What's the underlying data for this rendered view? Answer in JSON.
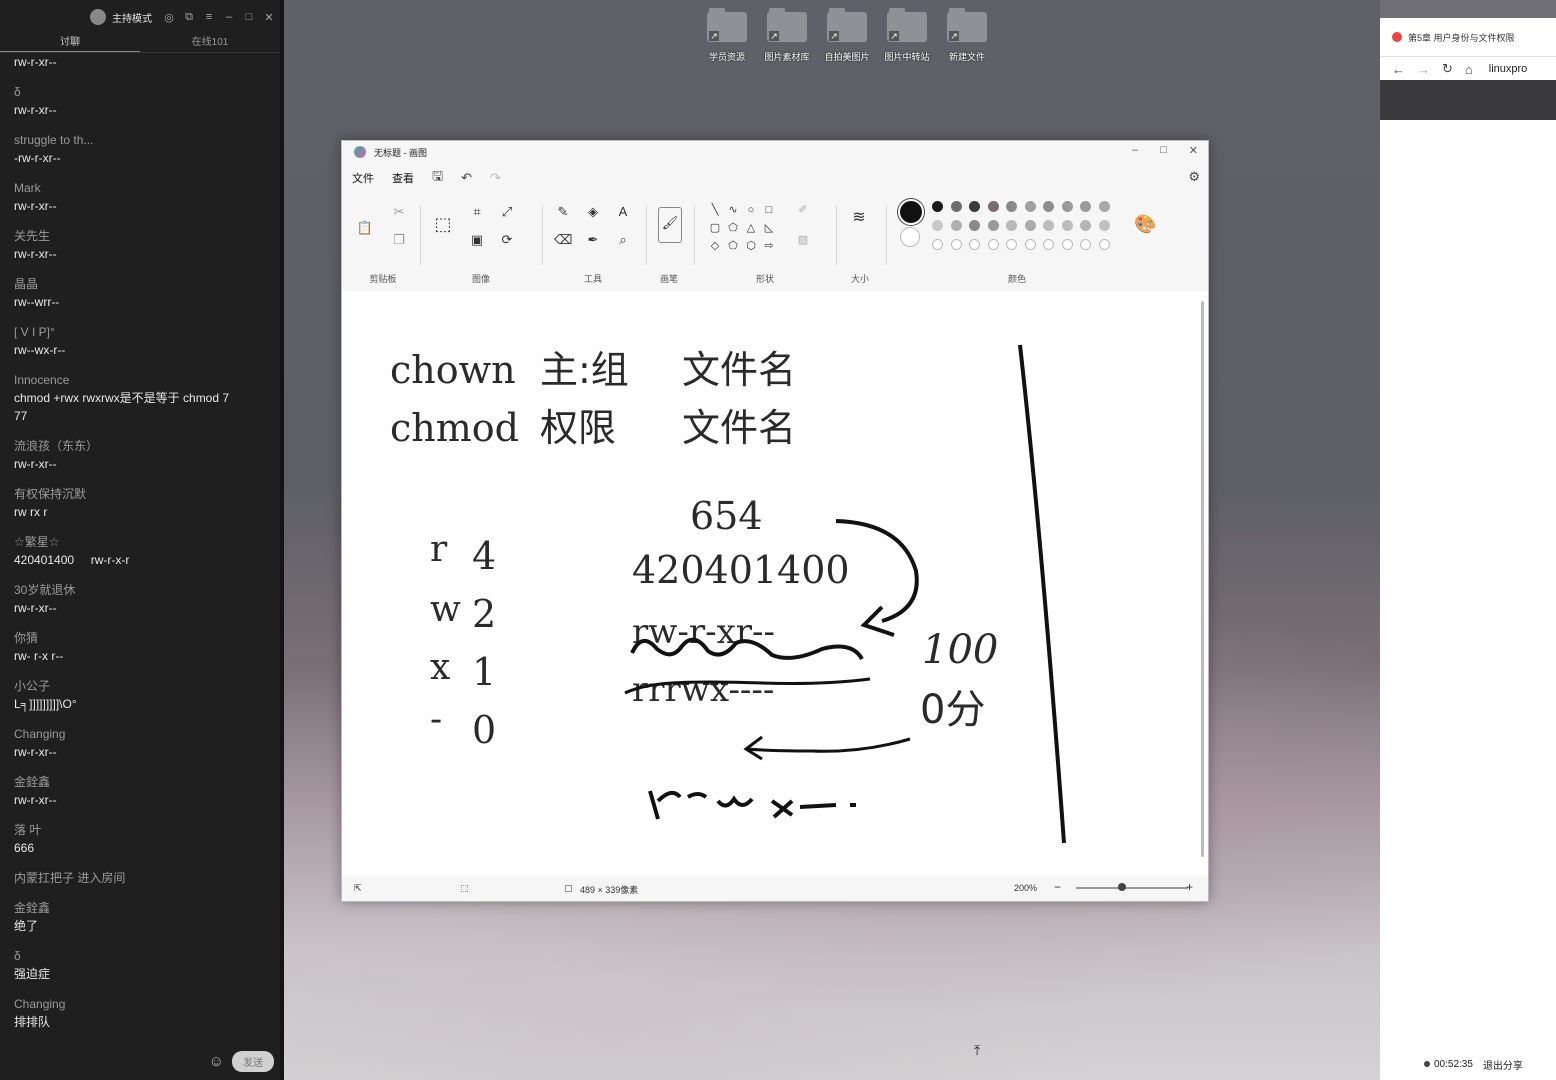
{
  "chat": {
    "title": "主持模式",
    "tabs": [
      "讨聊",
      "在线101"
    ],
    "messages": [
      {
        "name": "",
        "text": "rw-r-xr--"
      },
      {
        "name": "δ",
        "text": "rw-r-xr--"
      },
      {
        "name": "struggle to th...",
        "text": "-rw-r-xr--"
      },
      {
        "name": "Mark",
        "text": "rw-r-xr--"
      },
      {
        "name": "关先生",
        "text": "rw-r-xr--"
      },
      {
        "name": "晶晶",
        "text": "rw--wrr--"
      },
      {
        "name": "[    V      I       P]°",
        "text": "rw--wx-r--"
      },
      {
        "name": "Innocence",
        "text": "chmod +rwx rwxrwx是不是等于 chmod 7\n77"
      },
      {
        "name": "流浪孩（东东）",
        "text": "rw-r-xr--"
      },
      {
        "name": "有权保持沉默",
        "text": "rw rx r"
      },
      {
        "name": "☆繁星☆",
        "text": "420401400     rw-r-x-r"
      },
      {
        "name": "30岁就退休",
        "text": "rw-r-xr--"
      },
      {
        "name": "你猜",
        "text": "rw- r-x r--"
      },
      {
        "name": "小公子",
        "text": "L╕]]]]]]]]]\\O°"
      },
      {
        "name": "Changing",
        "text": "rw-r-xr--"
      },
      {
        "name": "金銓鑫",
        "text": "rw-r-xr--"
      },
      {
        "name": "   落    叶",
        "text": "666"
      },
      {
        "name": "内蒙扛把子 进入房间",
        "text": ""
      },
      {
        "name": "金銓鑫",
        "text": "绝了"
      },
      {
        "name": "δ",
        "text": "强迫症"
      },
      {
        "name": "Changing",
        "text": "排排队"
      }
    ],
    "send_label": "发送"
  },
  "desktop": {
    "icons": [
      "学员资源",
      "图片素材库",
      "自拍美图片",
      "图片中转站",
      "新建文件"
    ]
  },
  "browser": {
    "tab_title": "第5章 用户身份与文件权限",
    "url": "linuxpro",
    "timer": "00:52:35",
    "exit_label": "退出分享"
  },
  "paint": {
    "title": "无标题 - 画图",
    "menu": [
      "文件",
      "查看"
    ],
    "groups": [
      "剪贴板",
      "图像",
      "工具",
      "画笔",
      "形状",
      "大小",
      "颜色"
    ],
    "canvas_size": "489 × 339像素",
    "zoom": "200%",
    "canvas_text": {
      "line1_cmd": "chown",
      "line1_owner": "主:组",
      "line1_file": "文件名",
      "line2_cmd": "chmod",
      "line2_perm": "权限",
      "line2_file": "文件名",
      "perm_r": "r",
      "perm_w": "w",
      "perm_x": "x",
      "perm_dash": "-",
      "val_r": "4",
      "val_w": "2",
      "val_x": "1",
      "val_dash": "0",
      "octal": "654",
      "digits": "420401400",
      "perm_str1": "rw-r-xr--",
      "perm_str2": "rrrwx----",
      "score_top": "100",
      "score_bottom": "0分"
    }
  },
  "colors": {
    "swatches_row1": [
      "#1a1a1a",
      "#6e6e6e",
      "#3a3a3a",
      "#7a6a6a",
      "#8a8a8a",
      "#a0a0a0",
      "#8e8e8e",
      "#9a9a9a",
      "#9a9a9a",
      "#a8a8a8"
    ],
    "swatches_row2": [
      "#c8c8c8",
      "#b0b0b0",
      "#8a8a8a",
      "#9a9a9a",
      "#b8b8b8",
      "#aaaaaa",
      "#bcbcbc",
      "#bdbdbd",
      "#b4b4b4",
      "#c0c0c0"
    ]
  }
}
